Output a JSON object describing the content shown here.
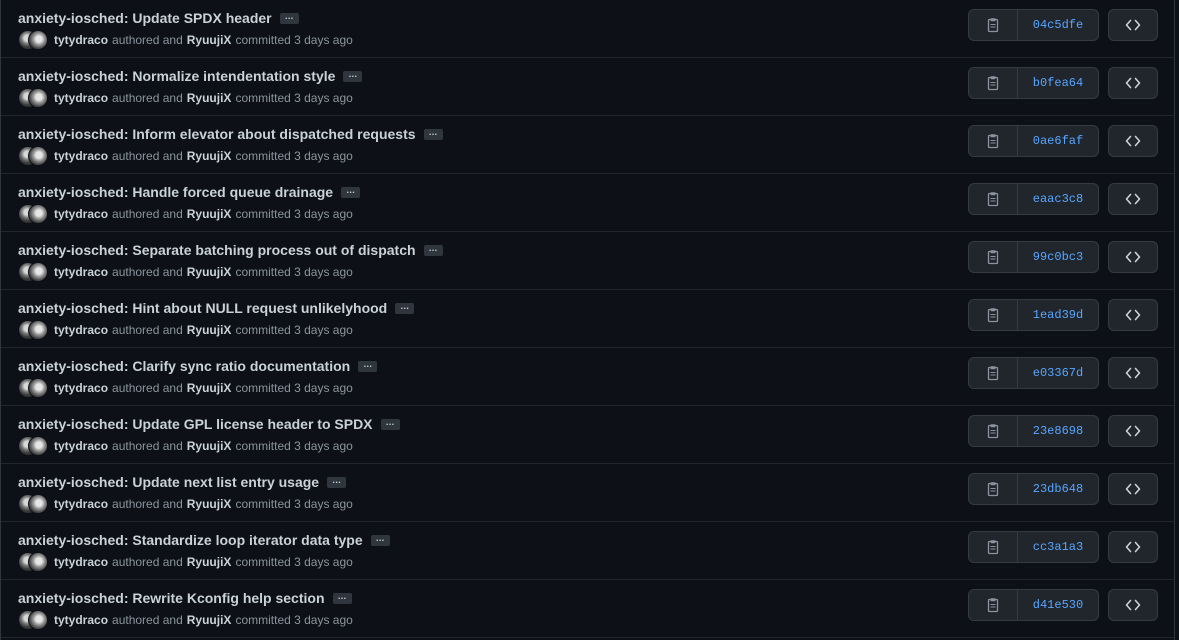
{
  "commits": [
    {
      "title": "anxiety-iosched: Update SPDX header",
      "ellipsis": "…",
      "author": "tytydraco",
      "authored": "authored and",
      "committer": "RyuujiX",
      "committed": "committed 3 days ago",
      "sha": "04c5dfe"
    },
    {
      "title": "anxiety-iosched: Normalize intendentation style",
      "ellipsis": "…",
      "author": "tytydraco",
      "authored": "authored and",
      "committer": "RyuujiX",
      "committed": "committed 3 days ago",
      "sha": "b0fea64"
    },
    {
      "title": "anxiety-iosched: Inform elevator about dispatched requests",
      "ellipsis": "…",
      "author": "tytydraco",
      "authored": "authored and",
      "committer": "RyuujiX",
      "committed": "committed 3 days ago",
      "sha": "0ae6faf"
    },
    {
      "title": "anxiety-iosched: Handle forced queue drainage",
      "ellipsis": "…",
      "author": "tytydraco",
      "authored": "authored and",
      "committer": "RyuujiX",
      "committed": "committed 3 days ago",
      "sha": "eaac3c8"
    },
    {
      "title": "anxiety-iosched: Separate batching process out of dispatch",
      "ellipsis": "…",
      "author": "tytydraco",
      "authored": "authored and",
      "committer": "RyuujiX",
      "committed": "committed 3 days ago",
      "sha": "99c0bc3"
    },
    {
      "title": "anxiety-iosched: Hint about NULL request unlikelyhood",
      "ellipsis": "…",
      "author": "tytydraco",
      "authored": "authored and",
      "committer": "RyuujiX",
      "committed": "committed 3 days ago",
      "sha": "1ead39d"
    },
    {
      "title": "anxiety-iosched: Clarify sync ratio documentation",
      "ellipsis": "…",
      "author": "tytydraco",
      "authored": "authored and",
      "committer": "RyuujiX",
      "committed": "committed 3 days ago",
      "sha": "e03367d"
    },
    {
      "title": "anxiety-iosched: Update GPL license header to SPDX",
      "ellipsis": "…",
      "author": "tytydraco",
      "authored": "authored and",
      "committer": "RyuujiX",
      "committed": "committed 3 days ago",
      "sha": "23e8698"
    },
    {
      "title": "anxiety-iosched: Update next list entry usage",
      "ellipsis": "…",
      "author": "tytydraco",
      "authored": "authored and",
      "committer": "RyuujiX",
      "committed": "committed 3 days ago",
      "sha": "23db648"
    },
    {
      "title": "anxiety-iosched: Standardize loop iterator data type",
      "ellipsis": "…",
      "author": "tytydraco",
      "authored": "authored and",
      "committer": "RyuujiX",
      "committed": "committed 3 days ago",
      "sha": "cc3a1a3"
    },
    {
      "title": "anxiety-iosched: Rewrite Kconfig help section",
      "ellipsis": "…",
      "author": "tytydraco",
      "authored": "authored and",
      "committer": "RyuujiX",
      "committed": "committed 3 days ago",
      "sha": "d41e530"
    }
  ],
  "icons": {
    "copy": "clipboard-icon",
    "browse": "code-icon"
  },
  "colors": {
    "background": "#0d1117",
    "sha_link": "#58a6ff",
    "button_bg": "#21262d",
    "muted_text": "#8b949e"
  }
}
